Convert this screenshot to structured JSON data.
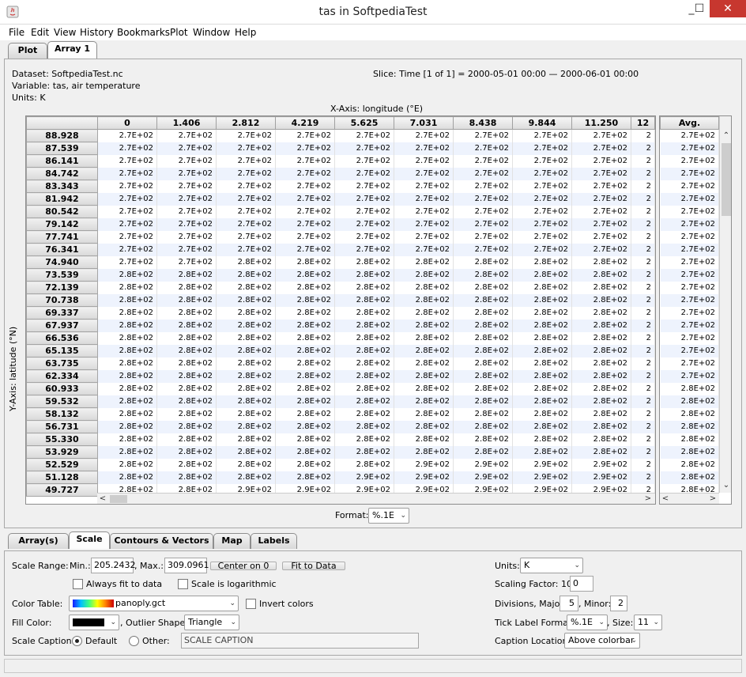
{
  "window": {
    "title": "tas in SoftpediaTest",
    "minimize": "_",
    "maximize": "☐",
    "close": "✕"
  },
  "menu": [
    "File",
    "Edit",
    "View",
    "History",
    "Bookmarks",
    "Plot",
    "Window",
    "Help"
  ],
  "top_tabs": [
    {
      "label": "Plot",
      "selected": false
    },
    {
      "label": "Array 1",
      "selected": true
    }
  ],
  "info": {
    "dataset": "Dataset: SoftpediaTest.nc",
    "variable": "Variable: tas, air temperature",
    "units": "Units: K",
    "slice": "Slice: Time [1 of 1] = 2000-05-01 00:00 — 2000-06-01 00:00"
  },
  "axes": {
    "x": "X-Axis: longitude (°E)",
    "y": "Y-Axis: latitude (°N)"
  },
  "columns": [
    "0",
    "1.406",
    "2.812",
    "4.219",
    "5.625",
    "7.031",
    "8.438",
    "9.844",
    "11.250",
    "12"
  ],
  "avg_header": "Avg.",
  "rows": [
    {
      "lat": "88.928",
      "v": [
        "2.7E+02",
        "2.7E+02",
        "2.7E+02",
        "2.7E+02",
        "2.7E+02",
        "2.7E+02",
        "2.7E+02",
        "2.7E+02",
        "2.7E+02",
        "2"
      ],
      "avg": "2.7E+02"
    },
    {
      "lat": "87.539",
      "v": [
        "2.7E+02",
        "2.7E+02",
        "2.7E+02",
        "2.7E+02",
        "2.7E+02",
        "2.7E+02",
        "2.7E+02",
        "2.7E+02",
        "2.7E+02",
        "2"
      ],
      "avg": "2.7E+02"
    },
    {
      "lat": "86.141",
      "v": [
        "2.7E+02",
        "2.7E+02",
        "2.7E+02",
        "2.7E+02",
        "2.7E+02",
        "2.7E+02",
        "2.7E+02",
        "2.7E+02",
        "2.7E+02",
        "2"
      ],
      "avg": "2.7E+02"
    },
    {
      "lat": "84.742",
      "v": [
        "2.7E+02",
        "2.7E+02",
        "2.7E+02",
        "2.7E+02",
        "2.7E+02",
        "2.7E+02",
        "2.7E+02",
        "2.7E+02",
        "2.7E+02",
        "2"
      ],
      "avg": "2.7E+02"
    },
    {
      "lat": "83.343",
      "v": [
        "2.7E+02",
        "2.7E+02",
        "2.7E+02",
        "2.7E+02",
        "2.7E+02",
        "2.7E+02",
        "2.7E+02",
        "2.7E+02",
        "2.7E+02",
        "2"
      ],
      "avg": "2.7E+02"
    },
    {
      "lat": "81.942",
      "v": [
        "2.7E+02",
        "2.7E+02",
        "2.7E+02",
        "2.7E+02",
        "2.7E+02",
        "2.7E+02",
        "2.7E+02",
        "2.7E+02",
        "2.7E+02",
        "2"
      ],
      "avg": "2.7E+02"
    },
    {
      "lat": "80.542",
      "v": [
        "2.7E+02",
        "2.7E+02",
        "2.7E+02",
        "2.7E+02",
        "2.7E+02",
        "2.7E+02",
        "2.7E+02",
        "2.7E+02",
        "2.7E+02",
        "2"
      ],
      "avg": "2.7E+02"
    },
    {
      "lat": "79.142",
      "v": [
        "2.7E+02",
        "2.7E+02",
        "2.7E+02",
        "2.7E+02",
        "2.7E+02",
        "2.7E+02",
        "2.7E+02",
        "2.7E+02",
        "2.7E+02",
        "2"
      ],
      "avg": "2.7E+02"
    },
    {
      "lat": "77.741",
      "v": [
        "2.7E+02",
        "2.7E+02",
        "2.7E+02",
        "2.7E+02",
        "2.7E+02",
        "2.7E+02",
        "2.7E+02",
        "2.7E+02",
        "2.7E+02",
        "2"
      ],
      "avg": "2.7E+02"
    },
    {
      "lat": "76.341",
      "v": [
        "2.7E+02",
        "2.7E+02",
        "2.7E+02",
        "2.7E+02",
        "2.7E+02",
        "2.7E+02",
        "2.7E+02",
        "2.7E+02",
        "2.7E+02",
        "2"
      ],
      "avg": "2.7E+02"
    },
    {
      "lat": "74.940",
      "v": [
        "2.7E+02",
        "2.7E+02",
        "2.8E+02",
        "2.8E+02",
        "2.8E+02",
        "2.8E+02",
        "2.8E+02",
        "2.8E+02",
        "2.8E+02",
        "2"
      ],
      "avg": "2.7E+02"
    },
    {
      "lat": "73.539",
      "v": [
        "2.8E+02",
        "2.8E+02",
        "2.8E+02",
        "2.8E+02",
        "2.8E+02",
        "2.8E+02",
        "2.8E+02",
        "2.8E+02",
        "2.8E+02",
        "2"
      ],
      "avg": "2.7E+02"
    },
    {
      "lat": "72.139",
      "v": [
        "2.8E+02",
        "2.8E+02",
        "2.8E+02",
        "2.8E+02",
        "2.8E+02",
        "2.8E+02",
        "2.8E+02",
        "2.8E+02",
        "2.8E+02",
        "2"
      ],
      "avg": "2.7E+02"
    },
    {
      "lat": "70.738",
      "v": [
        "2.8E+02",
        "2.8E+02",
        "2.8E+02",
        "2.8E+02",
        "2.8E+02",
        "2.8E+02",
        "2.8E+02",
        "2.8E+02",
        "2.8E+02",
        "2"
      ],
      "avg": "2.7E+02"
    },
    {
      "lat": "69.337",
      "v": [
        "2.8E+02",
        "2.8E+02",
        "2.8E+02",
        "2.8E+02",
        "2.8E+02",
        "2.8E+02",
        "2.8E+02",
        "2.8E+02",
        "2.8E+02",
        "2"
      ],
      "avg": "2.7E+02"
    },
    {
      "lat": "67.937",
      "v": [
        "2.8E+02",
        "2.8E+02",
        "2.8E+02",
        "2.8E+02",
        "2.8E+02",
        "2.8E+02",
        "2.8E+02",
        "2.8E+02",
        "2.8E+02",
        "2"
      ],
      "avg": "2.7E+02"
    },
    {
      "lat": "66.536",
      "v": [
        "2.8E+02",
        "2.8E+02",
        "2.8E+02",
        "2.8E+02",
        "2.8E+02",
        "2.8E+02",
        "2.8E+02",
        "2.8E+02",
        "2.8E+02",
        "2"
      ],
      "avg": "2.7E+02"
    },
    {
      "lat": "65.135",
      "v": [
        "2.8E+02",
        "2.8E+02",
        "2.8E+02",
        "2.8E+02",
        "2.8E+02",
        "2.8E+02",
        "2.8E+02",
        "2.8E+02",
        "2.8E+02",
        "2"
      ],
      "avg": "2.7E+02"
    },
    {
      "lat": "63.735",
      "v": [
        "2.8E+02",
        "2.8E+02",
        "2.8E+02",
        "2.8E+02",
        "2.8E+02",
        "2.8E+02",
        "2.8E+02",
        "2.8E+02",
        "2.8E+02",
        "2"
      ],
      "avg": "2.7E+02"
    },
    {
      "lat": "62.334",
      "v": [
        "2.8E+02",
        "2.8E+02",
        "2.8E+02",
        "2.8E+02",
        "2.8E+02",
        "2.8E+02",
        "2.8E+02",
        "2.8E+02",
        "2.8E+02",
        "2"
      ],
      "avg": "2.7E+02"
    },
    {
      "lat": "60.933",
      "v": [
        "2.8E+02",
        "2.8E+02",
        "2.8E+02",
        "2.8E+02",
        "2.8E+02",
        "2.8E+02",
        "2.8E+02",
        "2.8E+02",
        "2.8E+02",
        "2"
      ],
      "avg": "2.8E+02"
    },
    {
      "lat": "59.532",
      "v": [
        "2.8E+02",
        "2.8E+02",
        "2.8E+02",
        "2.8E+02",
        "2.8E+02",
        "2.8E+02",
        "2.8E+02",
        "2.8E+02",
        "2.8E+02",
        "2"
      ],
      "avg": "2.8E+02"
    },
    {
      "lat": "58.132",
      "v": [
        "2.8E+02",
        "2.8E+02",
        "2.8E+02",
        "2.8E+02",
        "2.8E+02",
        "2.8E+02",
        "2.8E+02",
        "2.8E+02",
        "2.8E+02",
        "2"
      ],
      "avg": "2.8E+02"
    },
    {
      "lat": "56.731",
      "v": [
        "2.8E+02",
        "2.8E+02",
        "2.8E+02",
        "2.8E+02",
        "2.8E+02",
        "2.8E+02",
        "2.8E+02",
        "2.8E+02",
        "2.8E+02",
        "2"
      ],
      "avg": "2.8E+02"
    },
    {
      "lat": "55.330",
      "v": [
        "2.8E+02",
        "2.8E+02",
        "2.8E+02",
        "2.8E+02",
        "2.8E+02",
        "2.8E+02",
        "2.8E+02",
        "2.8E+02",
        "2.8E+02",
        "2"
      ],
      "avg": "2.8E+02"
    },
    {
      "lat": "53.929",
      "v": [
        "2.8E+02",
        "2.8E+02",
        "2.8E+02",
        "2.8E+02",
        "2.8E+02",
        "2.8E+02",
        "2.8E+02",
        "2.8E+02",
        "2.8E+02",
        "2"
      ],
      "avg": "2.8E+02"
    },
    {
      "lat": "52.529",
      "v": [
        "2.8E+02",
        "2.8E+02",
        "2.8E+02",
        "2.8E+02",
        "2.8E+02",
        "2.9E+02",
        "2.9E+02",
        "2.9E+02",
        "2.9E+02",
        "2"
      ],
      "avg": "2.8E+02"
    },
    {
      "lat": "51.128",
      "v": [
        "2.8E+02",
        "2.8E+02",
        "2.8E+02",
        "2.8E+02",
        "2.9E+02",
        "2.9E+02",
        "2.9E+02",
        "2.9E+02",
        "2.9E+02",
        "2"
      ],
      "avg": "2.8E+02"
    },
    {
      "lat": "49.727",
      "v": [
        "2.8E+02",
        "2.8E+02",
        "2.9E+02",
        "2.9E+02",
        "2.9E+02",
        "2.9E+02",
        "2.9E+02",
        "2.9E+02",
        "2.9E+02",
        "2"
      ],
      "avg": "2.8E+02"
    }
  ],
  "format": {
    "label": "Format:",
    "value": "%.1E"
  },
  "bottom_tabs": [
    {
      "label": "Array(s)",
      "selected": false
    },
    {
      "label": "Scale",
      "selected": true
    },
    {
      "label": "Contours & Vectors",
      "selected": false
    },
    {
      "label": "Map",
      "selected": false
    },
    {
      "label": "Labels",
      "selected": false
    }
  ],
  "scale": {
    "range_label": "Scale Range:",
    "min_label": "Min.:",
    "min_value": "205.2432",
    "max_label": ", Max.:",
    "max_value": "309.0961",
    "center_button": "Center on 0",
    "fit_button": "Fit to Data",
    "always_fit": "Always fit to data",
    "logarithmic": "Scale is logarithmic",
    "color_table_label": "Color Table:",
    "color_table_value": "panoply.gct",
    "invert_colors": "Invert colors",
    "fill_color_label": "Fill Color:",
    "fill_color": "#000000",
    "outlier_label": ", Outlier Shape:",
    "outlier_value": "Triangle",
    "caption_label": "Scale Caption:",
    "default_radio": "Default",
    "other_radio": "Other:",
    "caption_value": "SCALE CAPTION",
    "units_label": "Units:",
    "units_value": "K",
    "scaling_label": "Scaling Factor: 10^",
    "scaling_value": "0",
    "divisions_label": "Divisions, Major:",
    "divisions_major": "5",
    "minor_label": ", Minor:",
    "divisions_minor": "2",
    "tick_format_label": "Tick Label Format:",
    "tick_format_value": "%.1E",
    "size_label": ", Size:",
    "size_value": "11",
    "caption_location_label": "Caption Location:",
    "caption_location_value": "Above colorbar"
  },
  "colors": {
    "title_close": "#c7372f",
    "row_stripe": "#eef3fd",
    "header_bg": "#dcdcdc"
  }
}
